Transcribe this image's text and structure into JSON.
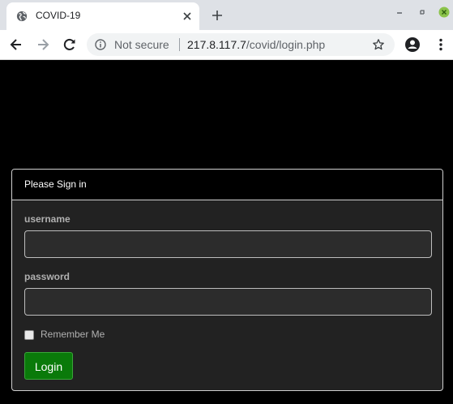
{
  "browser": {
    "tab_title": "COVID-19",
    "security_text": "Not secure",
    "url_host": "217.8.117.7",
    "url_path": "/covid/login.php",
    "icons": {
      "favicon": "globe-icon",
      "tab_close": "close-icon",
      "new_tab": "plus-icon",
      "back": "arrow-left-icon",
      "forward": "arrow-right-icon",
      "reload": "reload-icon",
      "info": "info-icon",
      "bookmark": "star-icon",
      "profile": "account-icon",
      "menu": "more-vert-icon",
      "window_close": "window-close-icon"
    },
    "colors": {
      "tabstrip": "#dee1e6",
      "window_close": "#8bc34a"
    }
  },
  "login": {
    "heading": "Please Sign in",
    "username_label": "username",
    "username_value": "",
    "password_label": "password",
    "password_value": "",
    "remember_label": "Remember Me",
    "remember_checked": false,
    "submit_label": "Login",
    "colors": {
      "page_bg": "#000000",
      "panel_bg": "#222222",
      "button": "#0a7a0a"
    }
  }
}
